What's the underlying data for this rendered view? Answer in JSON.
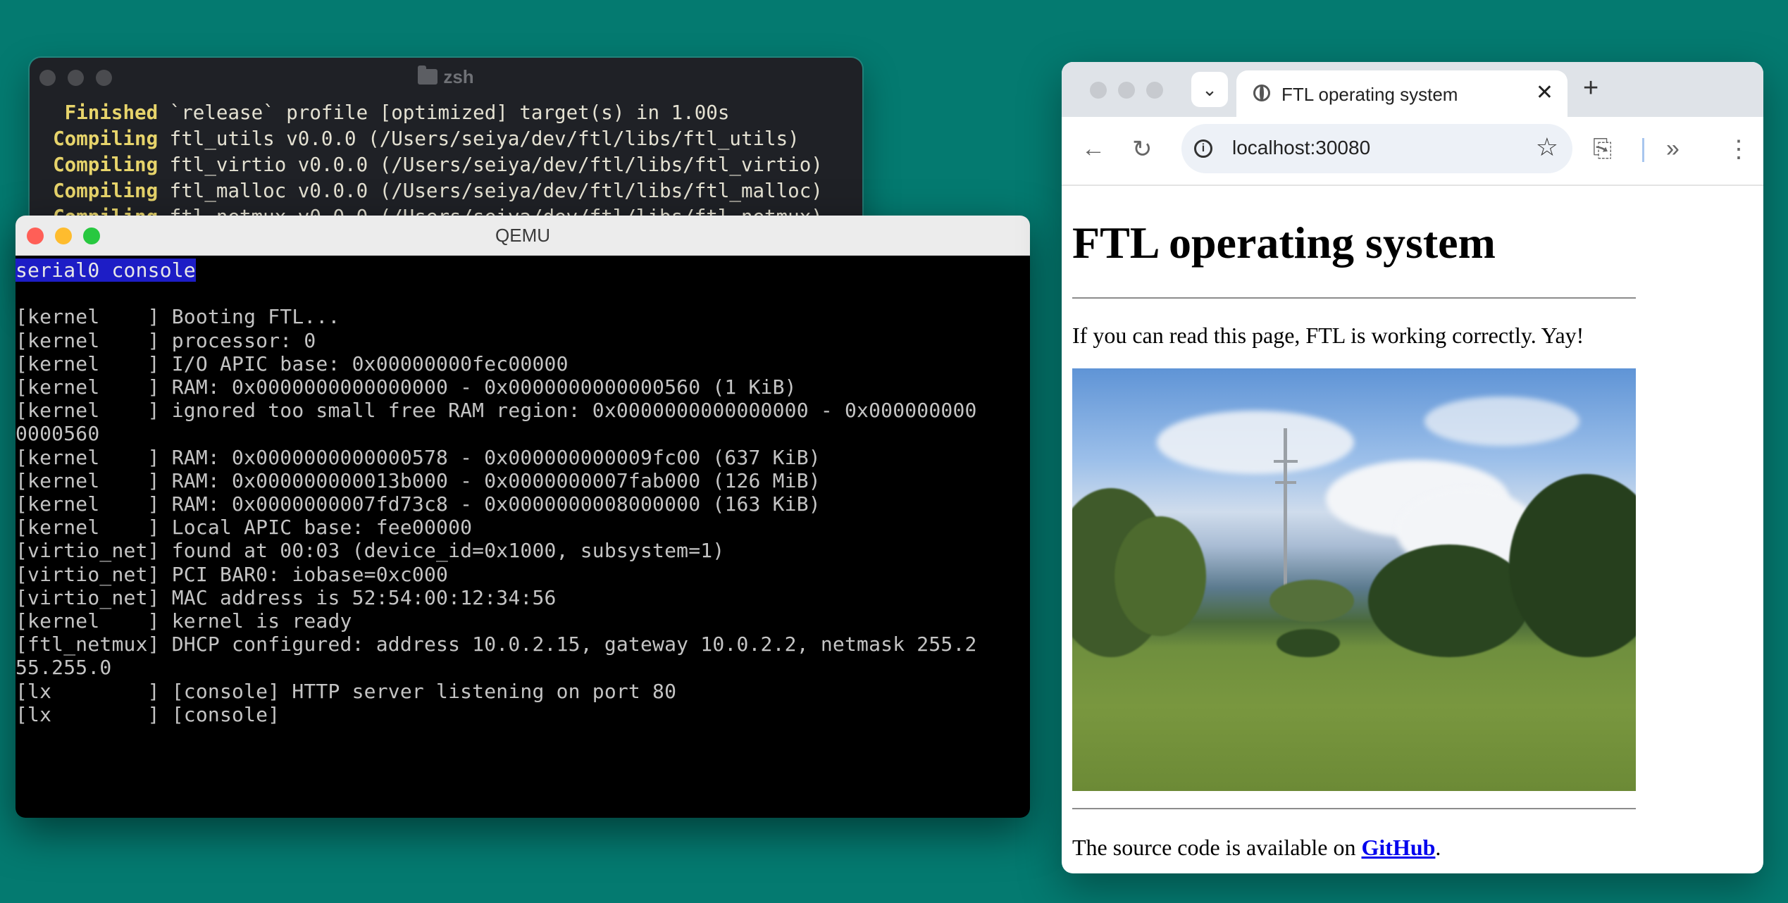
{
  "zsh": {
    "title": "zsh",
    "lines": [
      {
        "kw": "   Finished",
        "rest": " `release` profile [optimized] target(s) in 1.00s"
      },
      {
        "kw": "  Compiling",
        "rest": " ftl_utils v0.0.0 (/Users/seiya/dev/ftl/libs/ftl_utils)"
      },
      {
        "kw": "  Compiling",
        "rest": " ftl_virtio v0.0.0 (/Users/seiya/dev/ftl/libs/ftl_virtio)"
      },
      {
        "kw": "  Compiling",
        "rest": " ftl_malloc v0.0.0 (/Users/seiya/dev/ftl/libs/ftl_malloc)"
      },
      {
        "kw": "  Compiling",
        "rest": " ftl_netmux v0.0.0 (/Users/seiya/dev/ftl/libs/ftl_netmux)"
      }
    ]
  },
  "qemu": {
    "title": "QEMU",
    "console_label": "serial0 console",
    "lines": [
      "",
      "[kernel    ] Booting FTL...",
      "[kernel    ] processor: 0",
      "[kernel    ] I/O APIC base: 0x00000000fec00000",
      "[kernel    ] RAM: 0x0000000000000000 - 0x0000000000000560 (1 KiB)",
      "[kernel    ] ignored too small free RAM region: 0x0000000000000000 - 0x000000000",
      "0000560",
      "[kernel    ] RAM: 0x0000000000000578 - 0x000000000009fc00 (637 KiB)",
      "[kernel    ] RAM: 0x000000000013b000 - 0x0000000007fab000 (126 MiB)",
      "[kernel    ] RAM: 0x0000000007fd73c8 - 0x0000000008000000 (163 KiB)",
      "[kernel    ] Local APIC base: fee00000",
      "[virtio_net] found at 00:03 (device_id=0x1000, subsystem=1)",
      "[virtio_net] PCI BAR0: iobase=0xc000",
      "[virtio_net] MAC address is 52:54:00:12:34:56",
      "[kernel    ] kernel is ready",
      "[ftl_netmux] DHCP configured: address 10.0.2.15, gateway 10.0.2.2, netmask 255.2",
      "55.255.0",
      "[lx        ] [console] HTTP server listening on port 80",
      "[lx        ] [console]"
    ]
  },
  "browser": {
    "tab_title": "FTL operating system",
    "url": "localhost:30080",
    "page": {
      "heading": "FTL operating system",
      "intro": "If you can read this page, FTL is working correctly. Yay!",
      "source_prefix": "The source code is available on ",
      "source_link": "GitHub",
      "source_suffix": "."
    }
  },
  "colors": {
    "desktop": "#047a70",
    "close": "#ff5f57",
    "minimize": "#febc2e",
    "zoom": "#28c840",
    "compile_keyword": "#e7d46b",
    "link": "#0000ee"
  }
}
